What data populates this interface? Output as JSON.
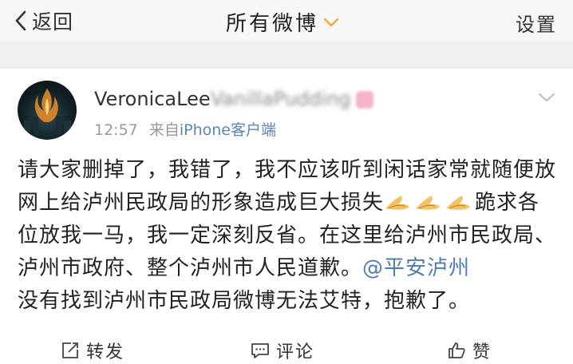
{
  "navbar": {
    "back_label": "返回",
    "title": "所有微博",
    "settings_label": "设置",
    "accent_color": "#f4a640"
  },
  "post": {
    "username": "VeronicaLee",
    "username_blurred": "VanillaPudding",
    "time": "12:57",
    "source_prefix": "来自",
    "source": "iPhone客户端",
    "content_1": "请大家删掉了，我错了，我不应该听到闲话家常就随便放网上给泸州民政局的形象造成巨大损失",
    "content_2": "跪求各位放我一马，我一定深刻反省。在这里给泸州市民政局、泸州市政府、整个泸州市人民道歉。",
    "mention": "@平安泸州",
    "content_3": "没有找到泸州市民政局微博无法艾特，抱歉了。",
    "emoji_icon": "praying-hands-emoji",
    "mention_color": "#4f7db3"
  },
  "actions": {
    "repost_label": "转发",
    "comment_label": "评论",
    "like_label": "赞"
  }
}
